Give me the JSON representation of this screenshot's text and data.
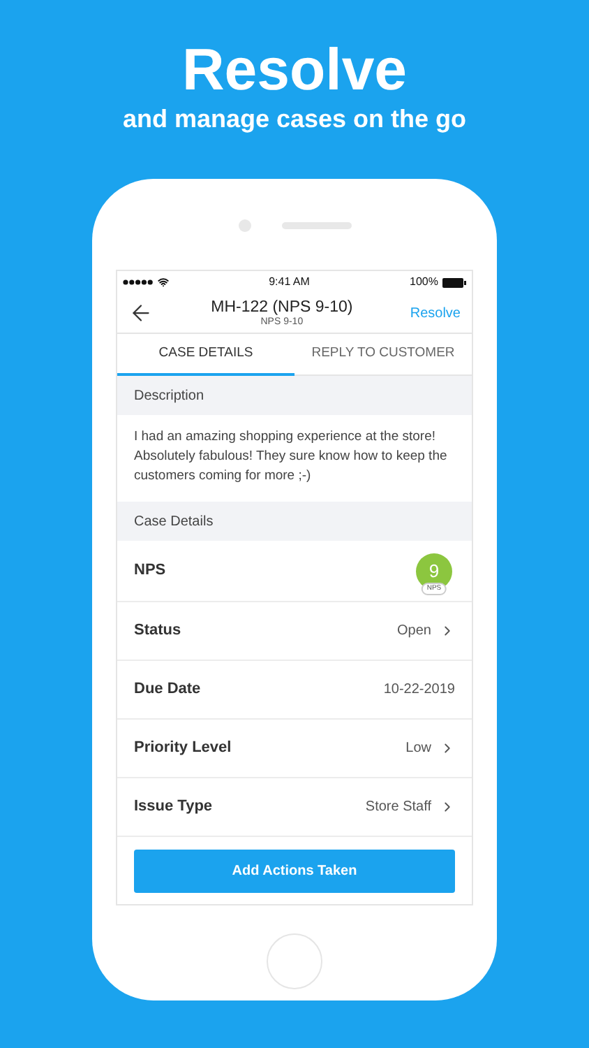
{
  "headline": {
    "title": "Resolve",
    "subtitle": "and manage cases on the go"
  },
  "status_bar": {
    "time": "9:41 AM",
    "battery": "100%"
  },
  "nav": {
    "title": "MH-122 (NPS 9-10)",
    "subtitle": "NPS 9-10",
    "action": "Resolve"
  },
  "tabs": [
    {
      "label": "CASE DETAILS",
      "selected": true
    },
    {
      "label": "REPLY TO CUSTOMER",
      "selected": false
    }
  ],
  "description": {
    "header": "Description",
    "text": "I had an amazing shopping experience at the store! Absolutely fabulous! They sure know how to keep the customers coming for more ;-)"
  },
  "case_details": {
    "header": "Case Details",
    "rows": [
      {
        "kind": "badge",
        "label": "NPS",
        "value": "9",
        "badge_label": "NPS",
        "color": "#8cc63f"
      },
      {
        "kind": "link",
        "label": "Status",
        "value": "Open"
      },
      {
        "kind": "plain",
        "label": "Due Date",
        "value": "10-22-2019"
      },
      {
        "kind": "link",
        "label": "Priority Level",
        "value": "Low"
      },
      {
        "kind": "link",
        "label": "Issue Type",
        "value": "Store Staff"
      }
    ]
  },
  "button": "Add Actions Taken"
}
